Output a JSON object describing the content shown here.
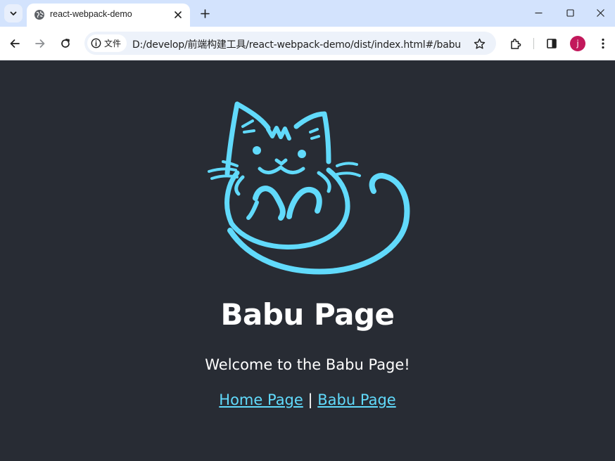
{
  "browser": {
    "tab": {
      "title": "react-webpack-demo"
    },
    "omnibox": {
      "site_chip_label": "文件",
      "url": "D:/develop/前端构建工具/react-webpack-demo/dist/index.html#/babu"
    },
    "profile_initial": "j",
    "profile_color": "#c2185b",
    "icons": {
      "tab_search": "chevron-down-icon",
      "favicon": "globe-icon",
      "tab_close": "close-icon",
      "new_tab": "plus-icon",
      "minimize": "minimize-icon",
      "maximize": "maximize-icon",
      "close_window": "close-icon",
      "back": "arrow-left-icon",
      "forward": "arrow-right-icon",
      "reload": "reload-icon",
      "site_info": "info-icon",
      "bookmark": "star-icon",
      "extensions": "puzzle-icon",
      "side_panel": "side-panel-icon",
      "menu": "kebab-menu-icon"
    }
  },
  "page": {
    "logo_icon": "cat-logo-icon",
    "title": "Babu Page",
    "welcome": "Welcome to the Babu Page!",
    "nav": {
      "home_link": "Home Page",
      "separator": "|",
      "babu_link": "Babu Page"
    },
    "colors": {
      "background": "#282c34",
      "accent": "#61dafb",
      "text": "#ffffff"
    }
  }
}
